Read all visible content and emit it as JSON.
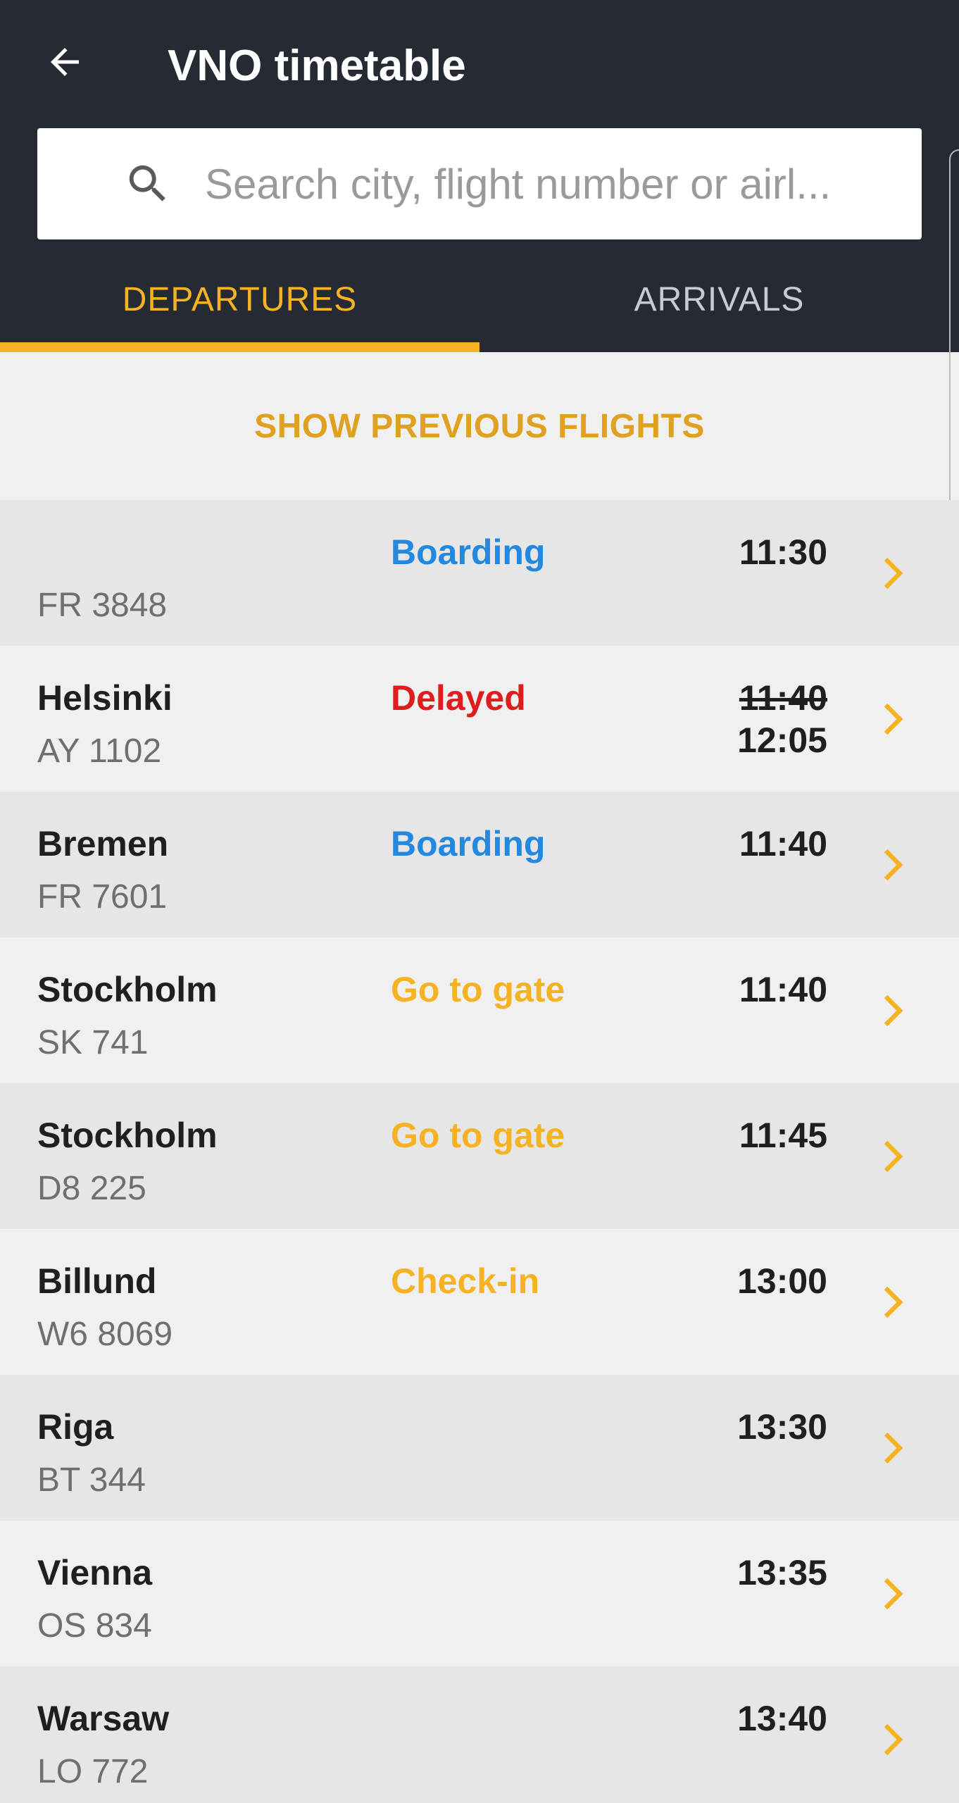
{
  "header": {
    "title": "VNO timetable",
    "back_icon": "arrow-left-icon"
  },
  "search": {
    "placeholder": "Search city, flight number or airl...",
    "value": ""
  },
  "tabs": [
    {
      "label": "DEPARTURES",
      "active": true
    },
    {
      "label": "ARRIVALS",
      "active": false
    }
  ],
  "show_previous_label": "SHOW PREVIOUS FLIGHTS",
  "colors": {
    "header_bg": "#262a33",
    "accent": "#f5b323",
    "boarding": "#2388e0",
    "delayed": "#e01d1d"
  },
  "flights": [
    {
      "city": "",
      "flight": "FR 3848",
      "status": "Boarding",
      "status_type": "boarding",
      "time": "11:30",
      "new_time": ""
    },
    {
      "city": "Helsinki",
      "flight": "AY 1102",
      "status": "Delayed",
      "status_type": "delayed",
      "time": "11:40",
      "new_time": "12:05"
    },
    {
      "city": "Bremen",
      "flight": "FR 7601",
      "status": "Boarding",
      "status_type": "boarding",
      "time": "11:40",
      "new_time": ""
    },
    {
      "city": "Stockholm",
      "flight": "SK 741",
      "status": "Go to gate",
      "status_type": "gate",
      "time": "11:40",
      "new_time": ""
    },
    {
      "city": "Stockholm",
      "flight": "D8 225",
      "status": "Go to gate",
      "status_type": "gate",
      "time": "11:45",
      "new_time": ""
    },
    {
      "city": "Billund",
      "flight": "W6 8069",
      "status": "Check-in",
      "status_type": "checkin",
      "time": "13:00",
      "new_time": ""
    },
    {
      "city": "Riga",
      "flight": "BT 344",
      "status": "",
      "status_type": "",
      "time": "13:30",
      "new_time": ""
    },
    {
      "city": "Vienna",
      "flight": "OS 834",
      "status": "",
      "status_type": "",
      "time": "13:35",
      "new_time": ""
    },
    {
      "city": "Warsaw",
      "flight": "LO 772",
      "status": "",
      "status_type": "",
      "time": "13:40",
      "new_time": ""
    }
  ]
}
